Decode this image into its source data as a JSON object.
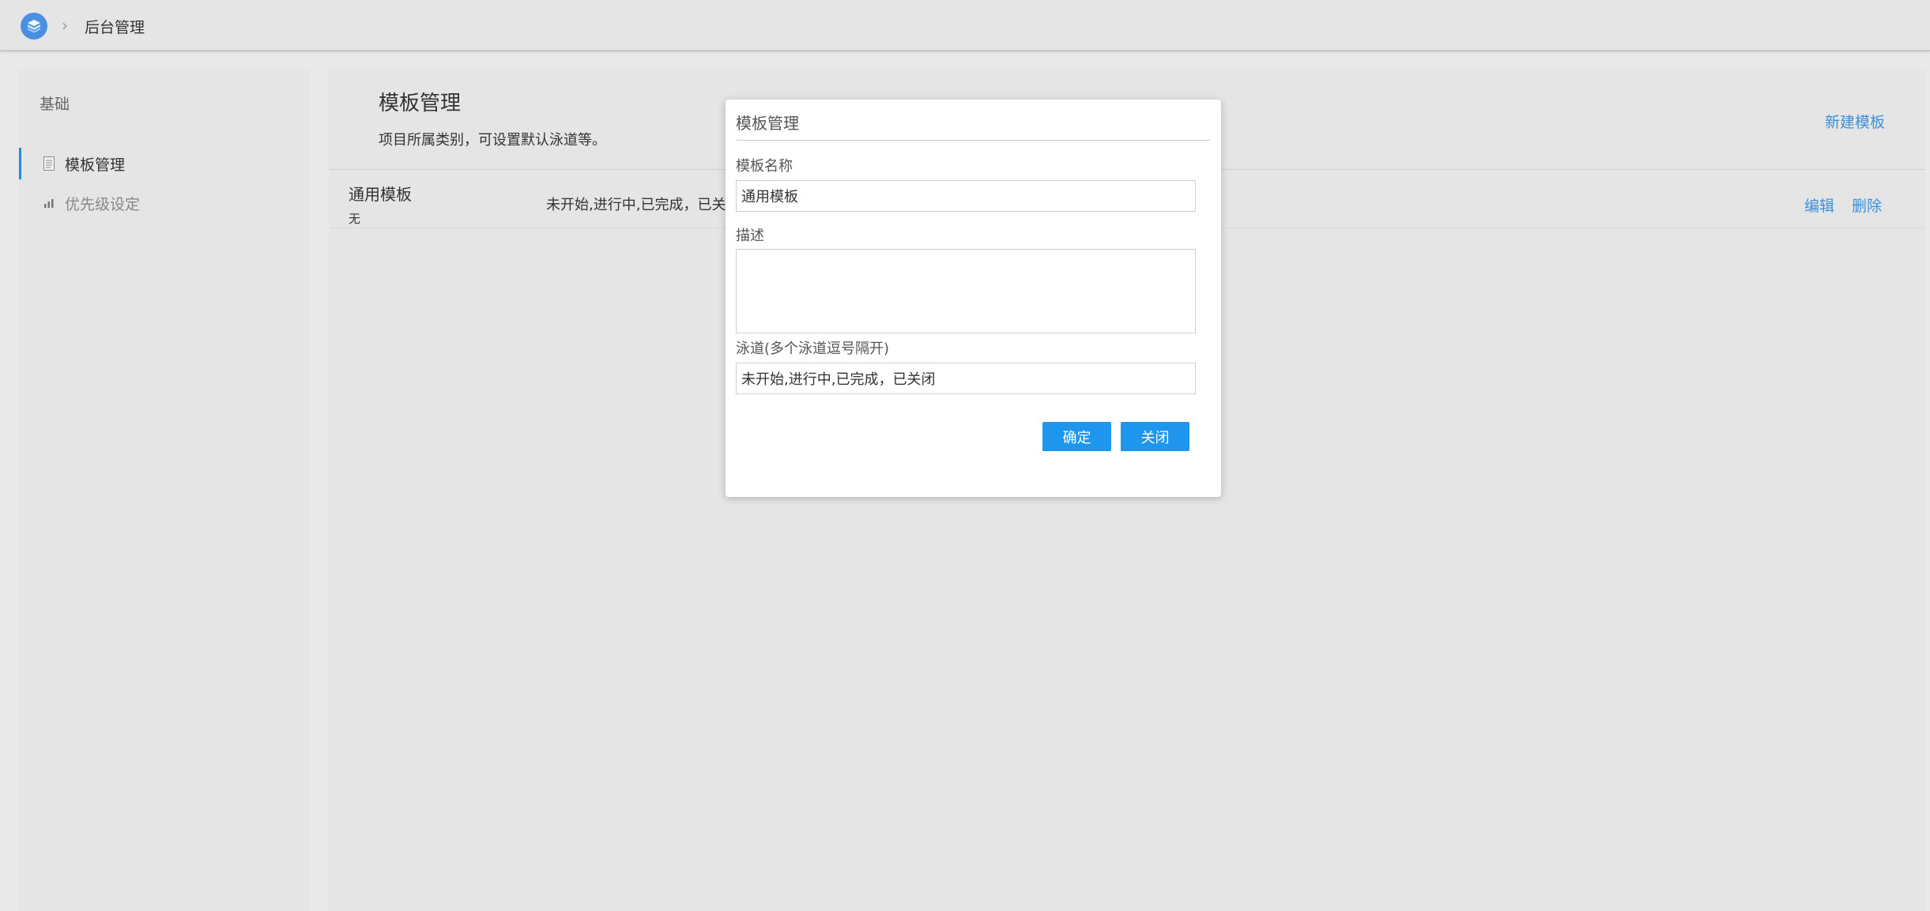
{
  "header": {
    "crumb_separator": "›",
    "title": "后台管理",
    "logo_icon": "cube-logo-icon"
  },
  "sidebar": {
    "group_label": "基础",
    "items": [
      {
        "label": "模板管理",
        "icon": "document-icon",
        "active": true
      },
      {
        "label": "优先级设定",
        "icon": "bar-chart-icon",
        "active": false
      }
    ]
  },
  "main": {
    "title": "模板管理",
    "description": "项目所属类别，可设置默认泳道等。",
    "new_label": "新建模板",
    "rows": [
      {
        "name": "通用模板",
        "description": "无",
        "lanes": "未开始,进行中,已完成，已关闭",
        "edit_label": "编辑",
        "delete_label": "删除"
      }
    ]
  },
  "modal": {
    "title": "模板管理",
    "name_label": "模板名称",
    "name_value": "通用模板",
    "desc_label": "描述",
    "desc_value": "",
    "lanes_label": "泳道(多个泳道逗号隔开)",
    "lanes_value": "未开始,进行中,已完成，已关闭",
    "confirm_label": "确定",
    "close_label": "关闭"
  },
  "colors": {
    "accent": "#1e96ee",
    "link": "#3b8fd8",
    "background": "#e9e9e9"
  }
}
